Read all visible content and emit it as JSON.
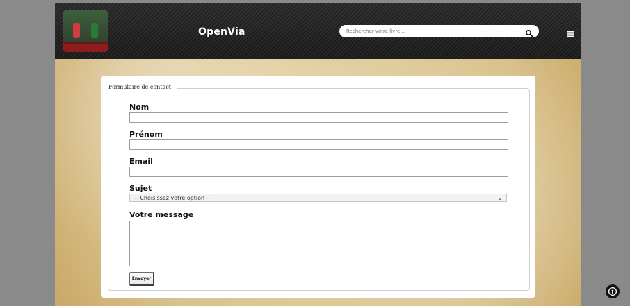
{
  "header": {
    "brand": "OpenVia",
    "search_placeholder": "Rechercher votre livre..."
  },
  "form": {
    "legend": "Formulaire de contact",
    "labels": {
      "nom": "Nom",
      "prenom": "Prénom",
      "email": "Email",
      "sujet": "Sujet",
      "message": "Votre message"
    },
    "subject_selected": "-- Choisissez votre option --",
    "submit_label": "Envoyer"
  },
  "icons": {
    "search": "search-icon",
    "menu": "hamburger-menu-icon",
    "scroll_top": "arrow-up-icon"
  },
  "colors": {
    "header_bg": "#1f1f1f",
    "page_outer_bg": "#8a8a8a",
    "card_bg": "#ffffff",
    "text": "#111111"
  }
}
